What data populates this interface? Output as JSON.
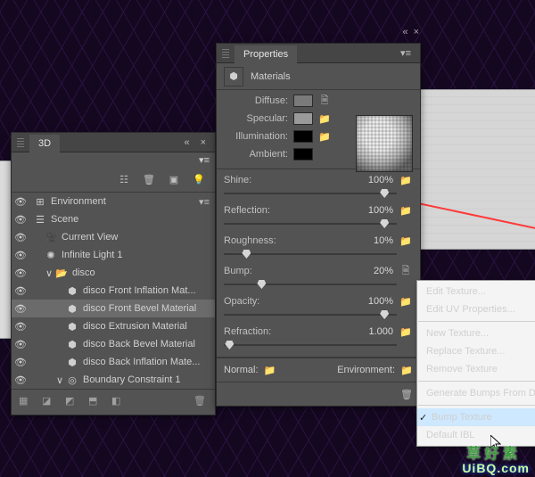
{
  "panel3d": {
    "title": "3D",
    "tree": {
      "environment": "Environment",
      "scene": "Scene",
      "current_view": "Current View",
      "infinite_light": "Infinite Light 1",
      "disco": "disco",
      "mats": [
        "disco Front Inflation Mat...",
        "disco Front Bevel Material",
        "disco Extrusion Material",
        "disco Back Bevel Material",
        "disco Back Inflation Mate..."
      ],
      "boundary": "Boundary Constraint 1"
    }
  },
  "props": {
    "title": "Properties",
    "subtitle": "Materials",
    "labels": {
      "diffuse": "Diffuse:",
      "specular": "Specular:",
      "illumination": "Illumination:",
      "ambient": "Ambient:"
    },
    "sliders": {
      "shine": {
        "label": "Shine:",
        "value": "100%",
        "pos": 85
      },
      "reflection": {
        "label": "Reflection:",
        "value": "100%",
        "pos": 85
      },
      "roughness": {
        "label": "Roughness:",
        "value": "10%",
        "pos": 12
      },
      "bump": {
        "label": "Bump:",
        "value": "20%",
        "pos": 20
      },
      "opacity": {
        "label": "Opacity:",
        "value": "100%",
        "pos": 85
      },
      "refraction": {
        "label": "Refraction:",
        "value": "1.000",
        "pos": 3
      }
    },
    "normal": "Normal:",
    "environment": "Environment:"
  },
  "ctx": {
    "edit_texture": "Edit Texture...",
    "edit_uv": "Edit UV Properties...",
    "new_texture": "New Texture...",
    "replace_texture": "Replace Texture...",
    "remove_texture": "Remove Texture",
    "generate_bumps": "Generate Bumps From D",
    "bump_texture": "Bump Texture",
    "default_ibl": "Default IBL"
  },
  "watermark": "UiBQ.com",
  "wm2": "草 好 素"
}
